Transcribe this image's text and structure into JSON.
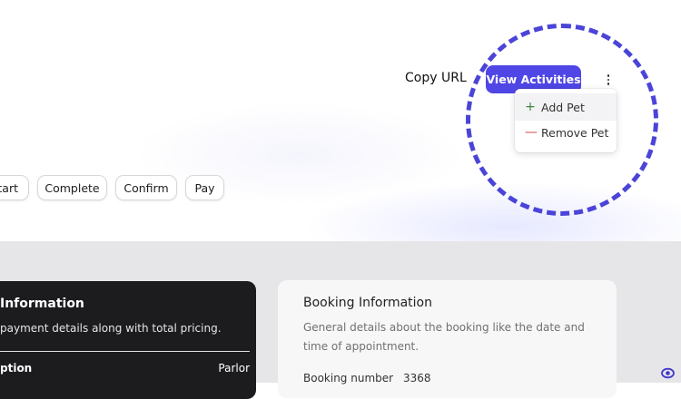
{
  "header": {
    "copy_url_label": "Copy URL",
    "view_activities_label": "View Activities",
    "menu_icon": "more-vertical-icon"
  },
  "dropdown": {
    "items": [
      {
        "label": "Add Pet",
        "icon": "plus-icon"
      },
      {
        "label": "Remove Pet",
        "icon": "minus-icon"
      }
    ]
  },
  "actions": {
    "start_label": "tart",
    "complete_label": "Complete",
    "confirm_label": "Confirm",
    "pay_label": "Pay"
  },
  "payment_card": {
    "title": "Information",
    "subtitle": "payment details along with total pricing.",
    "table_col_1": "ption",
    "table_col_2": "Parlor"
  },
  "booking_card": {
    "title": "Booking Information",
    "description": "General details about the booking like the date and time of appointment.",
    "number_label": "Booking number",
    "number_value": "3368"
  },
  "colors": {
    "accent": "#4f46e5",
    "highlight_ring": "#4a44d8",
    "dark_card": "#1c1c1e",
    "add_icon": "#3b8a3b",
    "remove_icon": "#d24a4a"
  },
  "floating_icon": "eye-icon"
}
